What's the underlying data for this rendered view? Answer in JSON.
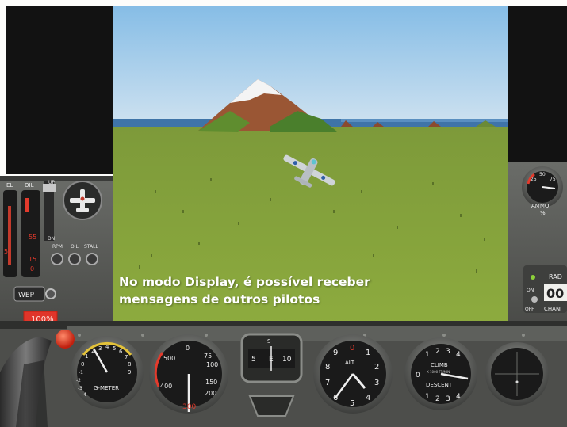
{
  "caption": {
    "line1": "No modo Display, é possível receber",
    "line2": "mensagens de outros pilotos"
  },
  "left_panel": {
    "fuel_label": "EL",
    "oil_label": "OIL",
    "flaps_up": "UP",
    "flaps_dn": "DN",
    "gauge_nums": [
      "55",
      "5",
      "15",
      "0"
    ],
    "warn_labels": [
      "RPM",
      "OIL",
      "STALL"
    ],
    "wep_label": "WEP",
    "throttle_percent": "100%"
  },
  "right_panel": {
    "ammo_label": "AMMO",
    "ammo_unit": "%",
    "ammo_ticks": [
      "25",
      "50",
      "75"
    ],
    "radio_label": "RAD",
    "radio_on": "ON",
    "radio_off": "OFF",
    "radio_channel_value": "00",
    "channel_label": "CHANI"
  },
  "instruments": {
    "gmeter_label": "G-METER",
    "gmeter_ticks": [
      "-4",
      "-3",
      "-2",
      "-1",
      "0",
      "1",
      "2",
      "3",
      "4",
      "5",
      "6",
      "7",
      "8",
      "9"
    ],
    "airspeed_ticks": [
      "0",
      "75",
      "100",
      "150",
      "200",
      "300",
      "400",
      "500"
    ],
    "compass_ticks": [
      "5",
      "E",
      "10",
      "S"
    ],
    "altimeter_label": "ALT",
    "altimeter_ticks": [
      "0",
      "1",
      "2",
      "3",
      "4",
      "5",
      "6",
      "7",
      "8",
      "9"
    ],
    "vsi_climb_label": "CLIMB",
    "vsi_descent_label": "DESCENT",
    "vsi_sub_label": "X 1000 FT/MIN",
    "vsi_ticks": [
      "0",
      "1",
      "2",
      "3",
      "4"
    ]
  },
  "colors": {
    "sky_top": "#8ec0e6",
    "sky_bottom": "#c8dff0",
    "ground": "#8aa43c",
    "panel": "#595b58",
    "warning_red": "#e0352a",
    "caption_text": "#ffffff"
  }
}
